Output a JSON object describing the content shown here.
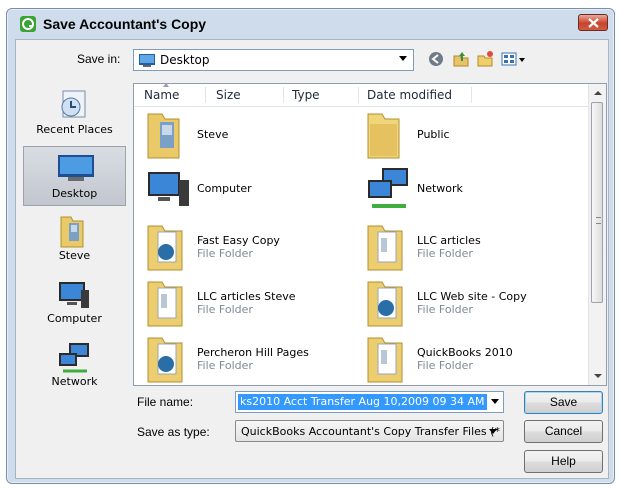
{
  "window": {
    "title": "Save Accountant's Copy"
  },
  "save_in": {
    "label": "Save in:",
    "value": "Desktop"
  },
  "places": [
    {
      "label": "Recent Places",
      "icon": "recent-places-icon"
    },
    {
      "label": "Desktop",
      "icon": "desktop-icon",
      "selected": true
    },
    {
      "label": "Steve",
      "icon": "user-folder-icon"
    },
    {
      "label": "Computer",
      "icon": "computer-icon"
    },
    {
      "label": "Network",
      "icon": "network-icon"
    }
  ],
  "columns": [
    "Name",
    "Size",
    "Type",
    "Date modified"
  ],
  "files": [
    {
      "name": "Steve",
      "type": "",
      "icon": "user-folder-icon"
    },
    {
      "name": "Public",
      "type": "",
      "icon": "folder-icon"
    },
    {
      "name": "Computer",
      "type": "",
      "icon": "computer-icon"
    },
    {
      "name": "Network",
      "type": "",
      "icon": "network-icon"
    },
    {
      "name": "Fast Easy Copy",
      "type": "File Folder",
      "icon": "document-folder-icon"
    },
    {
      "name": "LLC articles",
      "type": "File Folder",
      "icon": "document-folder-icon"
    },
    {
      "name": "LLC articles Steve",
      "type": "File Folder",
      "icon": "document-folder-icon"
    },
    {
      "name": "LLC Web site - Copy",
      "type": "File Folder",
      "icon": "document-folder-icon"
    },
    {
      "name": "Percheron Hill Pages",
      "type": "File Folder",
      "icon": "document-folder-icon"
    },
    {
      "name": "QuickBooks 2010",
      "type": "File Folder",
      "icon": "document-folder-icon"
    }
  ],
  "file_name": {
    "label": "File name:",
    "value": "ks2010 Acct Transfer Aug 10,2009  09 34 AM"
  },
  "save_as_type": {
    "label": "Save as type:",
    "value": "QuickBooks Accountant's Copy Transfer Files (*"
  },
  "buttons": {
    "save": "Save",
    "cancel": "Cancel",
    "help": "Help"
  },
  "colors": {
    "selection": "#3399ff",
    "frame": "#cfdcec"
  }
}
